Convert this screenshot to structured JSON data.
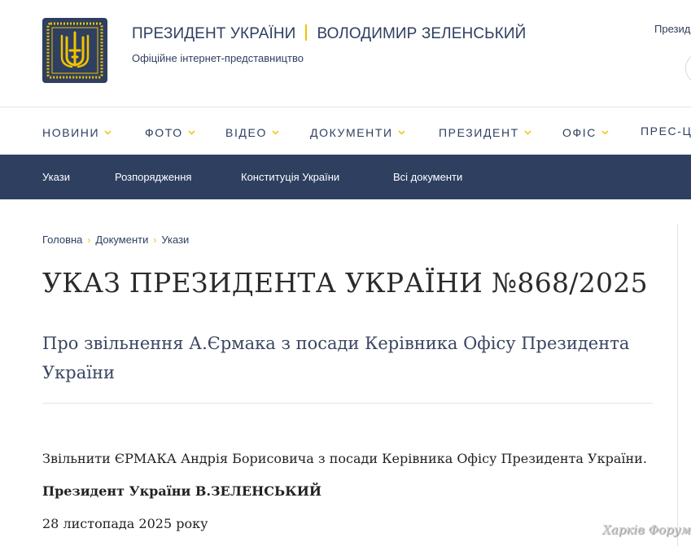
{
  "header": {
    "title_left": "ПРЕЗИДЕНТ УКРАЇНИ",
    "title_right": "ВОЛОДИМИР ЗЕЛЕНСЬКИЙ",
    "subtitle": "Офіційне інтернет-представництво",
    "top_right_text": "Презид"
  },
  "colors": {
    "brand": "#2e3f60",
    "accent": "#f2c200",
    "text": "#222222"
  },
  "nav": {
    "items": [
      {
        "label": "НОВИНИ",
        "has_dropdown": true
      },
      {
        "label": "ФОТО",
        "has_dropdown": true
      },
      {
        "label": "ВІДЕО",
        "has_dropdown": true
      },
      {
        "label": "ДОКУМЕНТИ",
        "has_dropdown": true
      },
      {
        "label": "ПРЕЗИДЕНТ",
        "has_dropdown": true
      },
      {
        "label": "ОФІС",
        "has_dropdown": true
      },
      {
        "label": "ПРЕС-ЦЕ",
        "has_dropdown": false
      }
    ]
  },
  "subnav": {
    "items": [
      {
        "label": "Укази"
      },
      {
        "label": "Розпорядження"
      },
      {
        "label": "Конституція України"
      },
      {
        "label": "Всі документи"
      }
    ]
  },
  "breadcrumb": [
    {
      "label": "Головна"
    },
    {
      "label": "Документи"
    },
    {
      "label": "Укази"
    }
  ],
  "article": {
    "title": "УКАЗ ПРЕЗИДЕНТА УКРАЇНИ №868/2025",
    "subtitle": "Про звільнення А.Єрмака з посади Керівника Офісу Президента України",
    "body": "Звільнити ЄРМАКА Андрія Борисовича з посади Керівника Офісу Президента України.",
    "signature": "Президент України В.ЗЕЛЕНСЬКИЙ",
    "date": "28 листопада 2025 року"
  },
  "watermark": "Харків Форум",
  "icons": {
    "logo": "trident-emblem-icon",
    "dropdown": "chevron-down-icon",
    "breadcrumb_separator": "chevron-right-icon"
  }
}
